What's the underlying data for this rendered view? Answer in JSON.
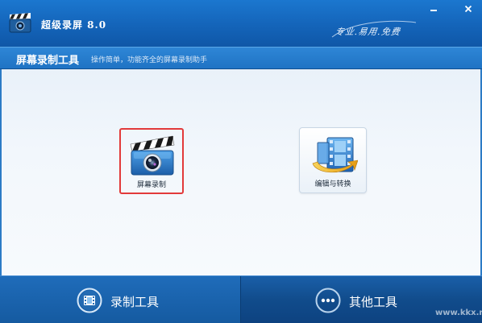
{
  "app": {
    "title": "超级录屏 8.0",
    "slogan": "专业.易用.免费"
  },
  "window_controls": {
    "minimize_icon": "minimize-icon",
    "close_icon": "close-icon"
  },
  "section": {
    "title": "屏幕录制工具",
    "subtitle": "操作简单，功能齐全的屏幕录制助手"
  },
  "tools": [
    {
      "label": "屏幕录制",
      "icon": "clapperboard-camera-icon",
      "selected": true
    },
    {
      "label": "编辑与转换",
      "icon": "film-convert-icon",
      "selected": false
    }
  ],
  "bottom_tabs": [
    {
      "label": "录制工具",
      "icon": "film-reel-icon",
      "active": true
    },
    {
      "label": "其他工具",
      "icon": "more-dots-icon",
      "active": false
    }
  ],
  "watermark": "www.kkx.net",
  "colors": {
    "title_bar": "#1464b9",
    "header_bar": "#2379c8",
    "content_bg": "#f2f7fc",
    "selection_border": "#e23a3a",
    "bottom_bar": "#114c8c"
  }
}
